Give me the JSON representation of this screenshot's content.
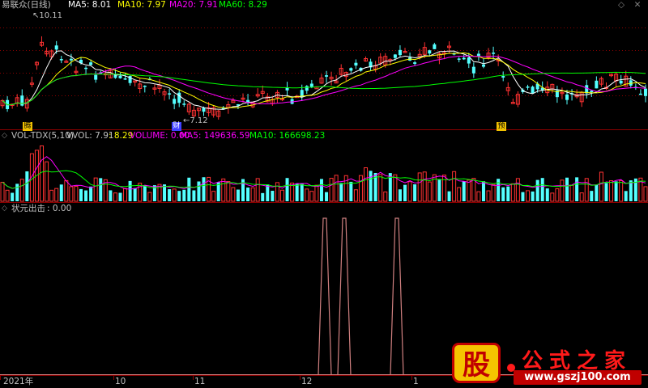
{
  "colors": {
    "up": "#ff3232",
    "down": "#54ffff",
    "ma5": "#ffffff",
    "ma10": "#ffff00",
    "ma20": "#ff00ff",
    "ma60": "#00ff00",
    "grid": "#8b0000",
    "signal": "#d08080",
    "text": "#c0c0c0"
  },
  "title": "易联众(日线)",
  "ma_legend": [
    {
      "label": "MA5: 8.01",
      "color": "#ffffff"
    },
    {
      "label": "MA10: 7.97",
      "color": "#ffff00"
    },
    {
      "label": "MA20: 7.91",
      "color": "#ff00ff"
    },
    {
      "label": "MA60: 8.29",
      "color": "#00ff00"
    }
  ],
  "price_high_label": "10.11",
  "price_low_label": "7.12",
  "markers": [
    "腾",
    "财",
    "预"
  ],
  "volume_panel": {
    "name": "VOL-TDX(5,10)",
    "vvol": "VVOL: 7.91",
    "vvol_val": ": 8.29",
    "volume": "VOLUME: 0.00",
    "ma5": "MA5: 149636.59",
    "ma10": "MA10: 166698.23"
  },
  "signal_panel": {
    "name": "状元出击",
    "value": ": 0.00"
  },
  "x_labels": [
    "2021年",
    "10",
    "11",
    "12",
    "1"
  ],
  "watermark": {
    "badge": "股",
    "title": "公式之家",
    "url": "www.gszj100.com"
  },
  "window_controls": [
    "minimize-icon",
    "close-icon"
  ]
}
